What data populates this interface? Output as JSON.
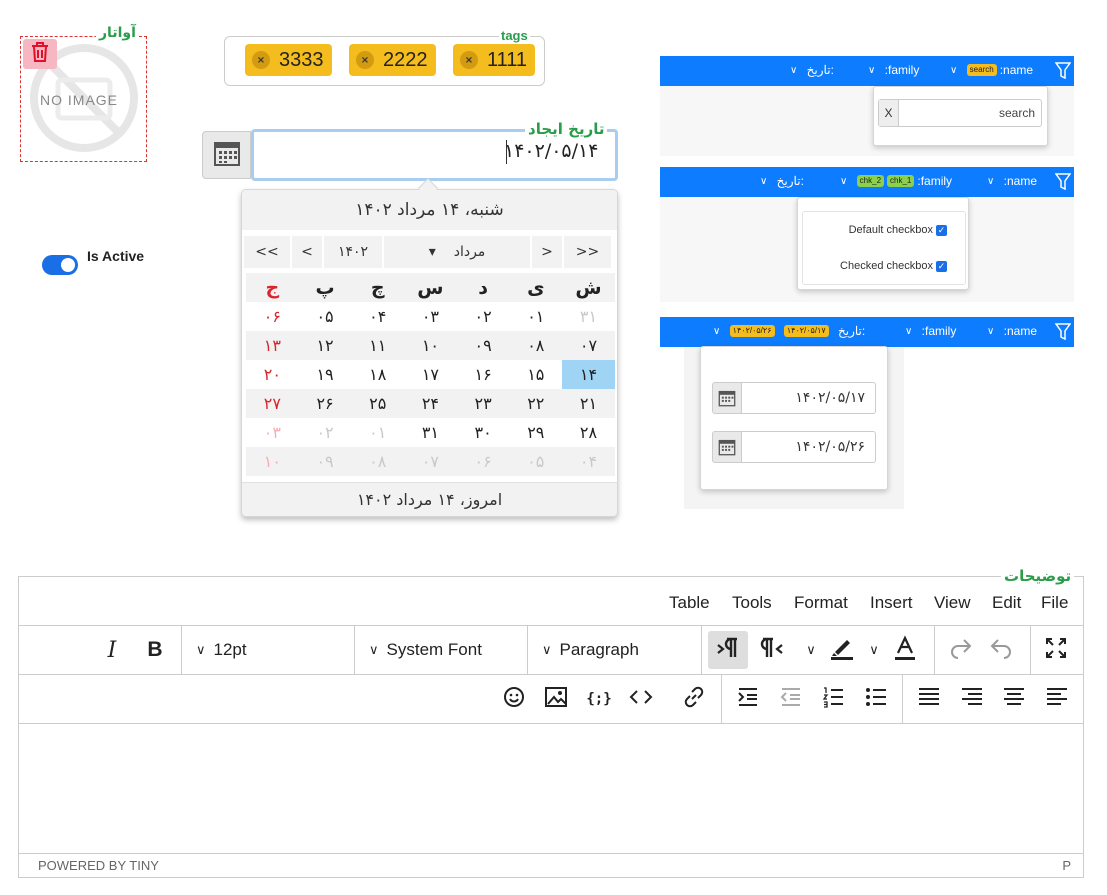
{
  "avatar": {
    "legend": "آواتار",
    "placeholder_text": "NO IMAGE",
    "delete_icon": "trash-icon"
  },
  "toggle": {
    "label": "Is Active",
    "checked": true,
    "accent": "#1b6fe6"
  },
  "tags": {
    "legend": "tags",
    "items": [
      "3333",
      "2222",
      "1111"
    ],
    "remove_symbol": "×",
    "color": "#f4bc1c"
  },
  "date_field": {
    "legend": "تاریخ ایجاد",
    "value": "۱۴۰۲/۰۵/۱۴"
  },
  "calendar": {
    "header": "شنبه، ۱۴ مرداد ۱۴۰۲",
    "nav": {
      "prev_year": "<<",
      "prev_month": "<",
      "year": "۱۴۰۲",
      "month": "مرداد",
      "next_month": ">",
      "next_year": ">>"
    },
    "weekdays": [
      "ش",
      "ی",
      "د",
      "س",
      "چ",
      "پ",
      "ج"
    ],
    "weeks": [
      [
        "۳۱",
        "۰۱",
        "۰۲",
        "۰۳",
        "۰۴",
        "۰۵",
        "۰۶"
      ],
      [
        "۰۷",
        "۰۸",
        "۰۹",
        "۱۰",
        "۱۱",
        "۱۲",
        "۱۳"
      ],
      [
        "۱۴",
        "۱۵",
        "۱۶",
        "۱۷",
        "۱۸",
        "۱۹",
        "۲۰"
      ],
      [
        "۲۱",
        "۲۲",
        "۲۳",
        "۲۴",
        "۲۵",
        "۲۶",
        "۲۷"
      ],
      [
        "۲۸",
        "۲۹",
        "۳۰",
        "۳۱",
        "۰۱",
        "۰۲",
        "۰۳"
      ],
      [
        "۰۴",
        "۰۵",
        "۰۶",
        "۰۷",
        "۰۸",
        "۰۹",
        "۱۰"
      ]
    ],
    "footer": "امروز، ۱۴ مرداد ۱۴۰۲",
    "selected_color": "#9fd4f5",
    "holiday_color": "#d9262e"
  },
  "filter_bars": [
    {
      "name_label": ":name",
      "name_chip": "search",
      "family_label": ":family",
      "date_label": "تاریخ:",
      "search": {
        "clear": "X",
        "value": "search"
      }
    },
    {
      "name_label": ":name",
      "family_label": ":family",
      "family_chips": [
        "chk_2",
        "chk_1"
      ],
      "date_label": "تاریخ:",
      "checkboxes": [
        {
          "label": "Default checkbox",
          "checked": true
        },
        {
          "label": "Checked checkbox",
          "checked": true
        }
      ]
    },
    {
      "name_label": ":name",
      "family_label": ":family",
      "date_label": "تاریخ:",
      "date_chips": [
        "۱۴۰۲/۰۵/۱۷",
        "۱۴۰۲/۰۵/۲۶"
      ],
      "dates": [
        "۱۴۰۲/۰۵/۱۷",
        "۱۴۰۲/۰۵/۲۶"
      ]
    }
  ],
  "editor": {
    "legend": "توضیحات",
    "menu": [
      "File",
      "Edit",
      "View",
      "Insert",
      "Format",
      "Tools",
      "Table"
    ],
    "font_size": "12pt",
    "font_family": "System Font",
    "block_format": "Paragraph",
    "bold": "B",
    "italic": "I",
    "status_left": "POWERED BY TINY",
    "status_right": "P"
  }
}
